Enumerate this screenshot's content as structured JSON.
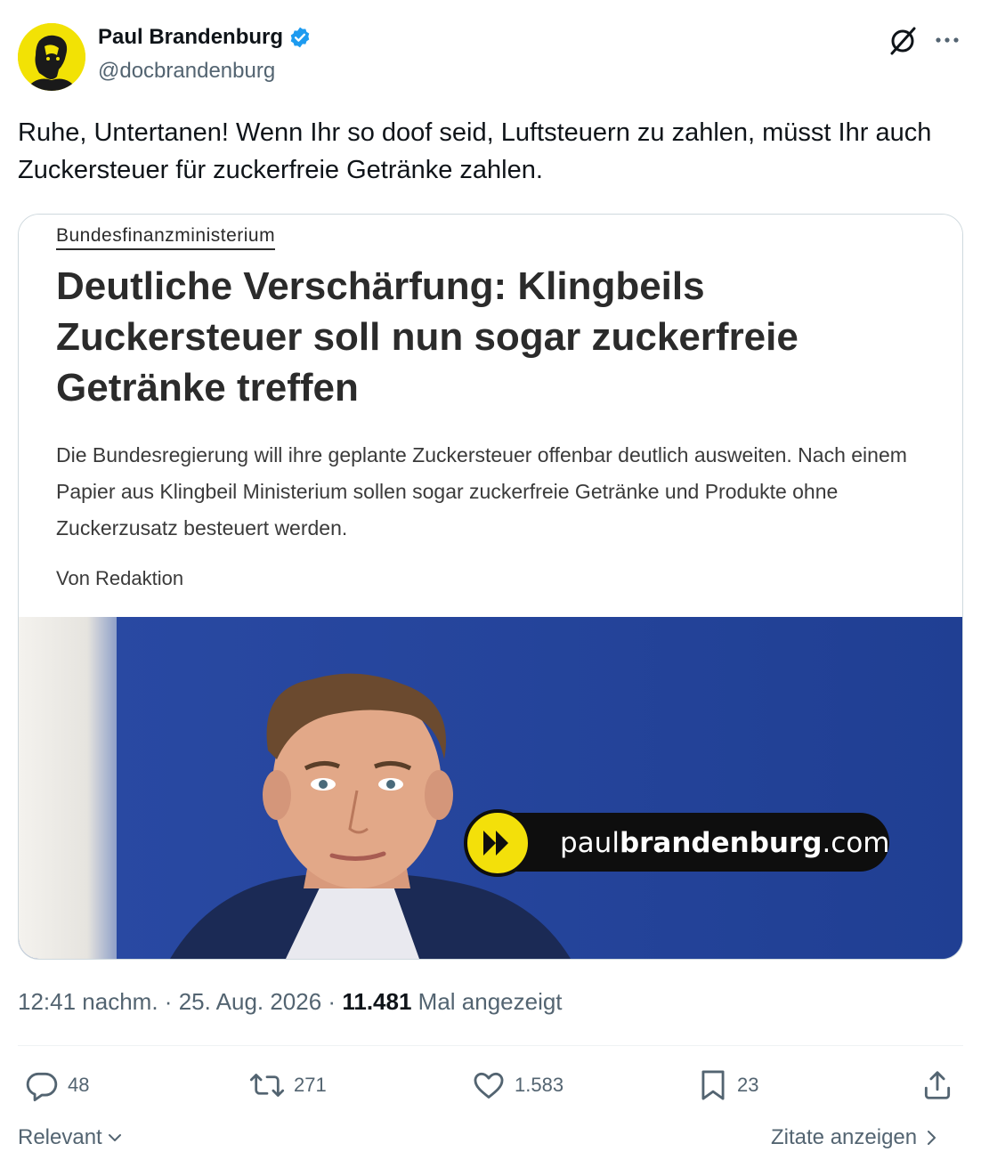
{
  "author": {
    "name": "Paul Brandenburg",
    "handle": "@docbrandenburg",
    "verified": true,
    "verified_color": "#1d9bf0",
    "avatar_bg": "#f2e205"
  },
  "tweet": {
    "text": "Ruhe, Untertanen! Wenn Ihr so doof seid, Luftsteuern zu zahlen, müsst Ihr auch Zuckersteuer für zuckerfreie Getränke zahlen."
  },
  "card": {
    "kicker": "Bundesfinanzministerium",
    "headline": "Deutliche Verschärfung: Klingbeils Zuckersteuer soll nun sogar zuckerfreie Getränke treffen",
    "lede": "Die Bundesregierung will ihre geplante Zuckersteuer offenbar deutlich ausweiten. Nach einem Papier aus Klingbeil Ministerium sollen sogar zuckerfreie Getränke und Produkte ohne Zuckerzusatz besteuert werden.",
    "byline": "Von Redaktion",
    "watermark_prefix": "paul",
    "watermark_bold": "brandenburg",
    "watermark_suffix": ".com",
    "photo_bg": "#24449a"
  },
  "meta": {
    "time": "12:41 nachm.",
    "separator": "·",
    "date": "25. Aug. 2026",
    "views_count": "11.481",
    "views_label": "Mal angezeigt"
  },
  "actions": {
    "replies": "48",
    "retweets": "271",
    "likes": "1.583",
    "bookmarks": "23"
  },
  "footer": {
    "sort_label": "Relevant",
    "quotes_label": "Zitate anzeigen"
  }
}
